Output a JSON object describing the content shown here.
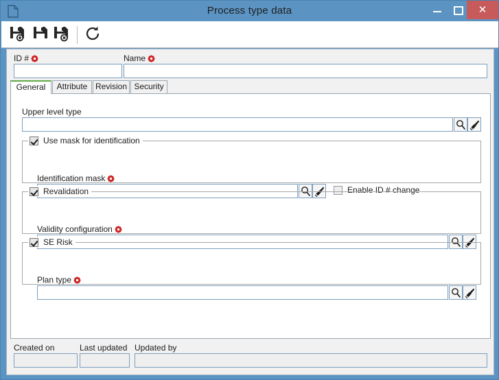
{
  "window": {
    "title": "Process type data",
    "doc_icon": "document-icon",
    "controls": {
      "minimize": "–",
      "maximize": "□",
      "close": "✕"
    },
    "colors": {
      "titlebar": "#5b93c2",
      "close_button": "#c75b5b",
      "active_tab_accent": "#5faa43",
      "required_marker": "#cc2222",
      "client_background": "#f1f1f1",
      "panel_background": "#ffffff",
      "input_border": "#7c9fbe"
    }
  },
  "toolbar": {
    "buttons": [
      {
        "name": "save-new-button",
        "icon": "save-new-icon",
        "label": "Save new"
      },
      {
        "name": "save-button",
        "icon": "save-icon",
        "label": "Save"
      },
      {
        "name": "save-delete-button",
        "icon": "save-delete-icon",
        "label": "Save and delete"
      },
      {
        "name": "refresh-button",
        "icon": "refresh-icon",
        "label": "Refresh"
      }
    ]
  },
  "header": {
    "id_label": "ID #",
    "id_value": "",
    "name_label": "Name",
    "name_value": ""
  },
  "tabs": [
    {
      "label": "General",
      "active": true
    },
    {
      "label": "Attribute",
      "active": false
    },
    {
      "label": "Revision",
      "active": false
    },
    {
      "label": "Security",
      "active": false
    }
  ],
  "general": {
    "upper_level_type": {
      "label": "Upper level type",
      "value": "",
      "lookup_icon": "magnifier-icon",
      "clear_icon": "brush-icon"
    },
    "mask_group": {
      "legend": "Use mask for identification",
      "checked": true,
      "field_label": "Identification mask",
      "field_value": "",
      "lookup_icon": "magnifier-icon",
      "clear_icon": "brush-icon",
      "enable_id_change_label": "Enable ID # change",
      "enable_id_change_checked": false
    },
    "revalidation_group": {
      "legend": "Revalidation",
      "checked": true,
      "field_label": "Validity configuration",
      "field_value": "",
      "lookup_icon": "magnifier-icon",
      "clear_icon": "brush-icon"
    },
    "se_risk_group": {
      "legend": "SE Risk",
      "checked": true,
      "field_label": "Plan type",
      "field_value": "",
      "lookup_icon": "magnifier-icon",
      "clear_icon": "brush-icon"
    }
  },
  "footer": {
    "created_on_label": "Created on",
    "created_on_value": "",
    "last_updated_label": "Last updated",
    "last_updated_value": "",
    "updated_by_label": "Updated by",
    "updated_by_value": ""
  }
}
